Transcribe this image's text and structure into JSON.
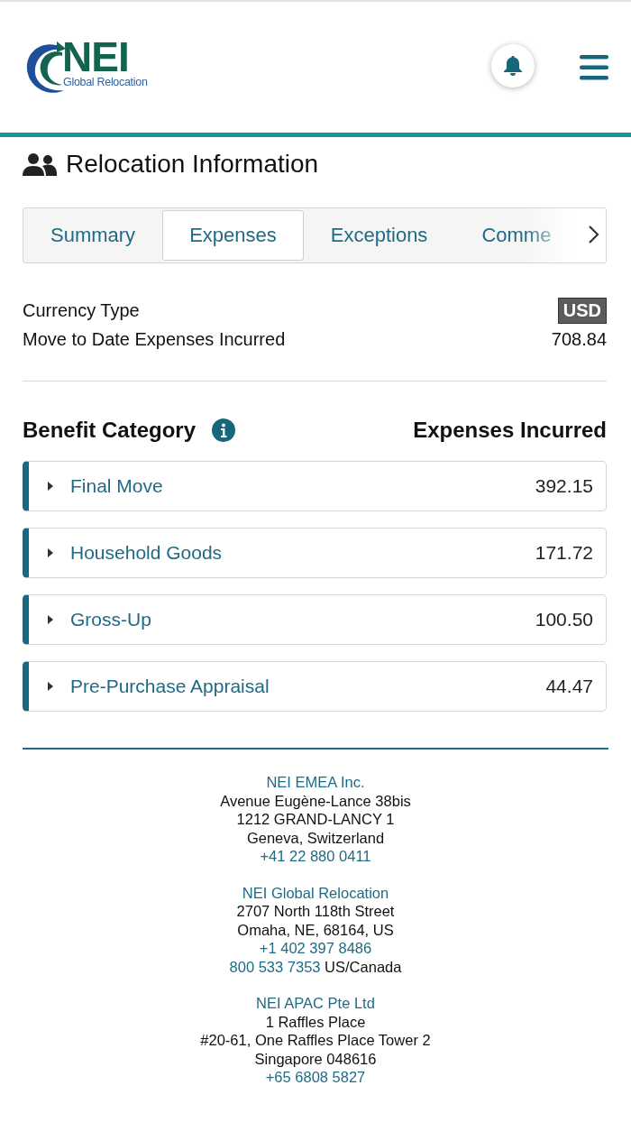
{
  "header": {
    "logo": {
      "wordmark": "NEI",
      "tagline": "Global Relocation"
    }
  },
  "page_title": "Relocation Information",
  "tabs": [
    {
      "label": "Summary",
      "selected": false
    },
    {
      "label": "Expenses",
      "selected": true
    },
    {
      "label": "Exceptions",
      "selected": false
    },
    {
      "label": "Comme",
      "selected": false
    }
  ],
  "summary": [
    {
      "label": "Currency Type",
      "value": "USD",
      "kind": "badge"
    },
    {
      "label": "Move to Date Expenses Incurred",
      "value": "708.84",
      "kind": "text"
    }
  ],
  "categories_header": {
    "category": "Benefit Category",
    "amount": "Expenses Incurred"
  },
  "categories": [
    {
      "name": "Final Move",
      "amount": "392.15",
      "expanded": false
    },
    {
      "name": "Household Goods",
      "amount": "171.72",
      "expanded": false
    },
    {
      "name": "Gross-Up",
      "amount": "100.50",
      "expanded": false
    },
    {
      "name": "Pre-Purchase Appraisal",
      "amount": "44.47",
      "expanded": false
    }
  ],
  "offices": [
    {
      "name": "NEI EMEA Inc.",
      "lines": [
        "Avenue Eugène-Lance 38bis",
        "1212 GRAND-LANCY 1",
        "Geneva, Switzerland"
      ],
      "phones": [
        {
          "number": "+41 22 880 0411"
        }
      ]
    },
    {
      "name": "NEI Global Relocation",
      "lines": [
        "2707 North 118th Street",
        "Omaha, NE, 68164, US"
      ],
      "phones": [
        {
          "number": "+1 402 397 8486"
        },
        {
          "number": "800 533 7353",
          "note": "US/Canada"
        }
      ]
    },
    {
      "name": "NEI APAC Pte Ltd",
      "lines": [
        "1 Raffles Place",
        "#20-61, One Raffles Place Tower 2",
        "Singapore 048616"
      ],
      "phones": [
        {
          "number": "+65 6808 5827"
        }
      ]
    }
  ]
}
